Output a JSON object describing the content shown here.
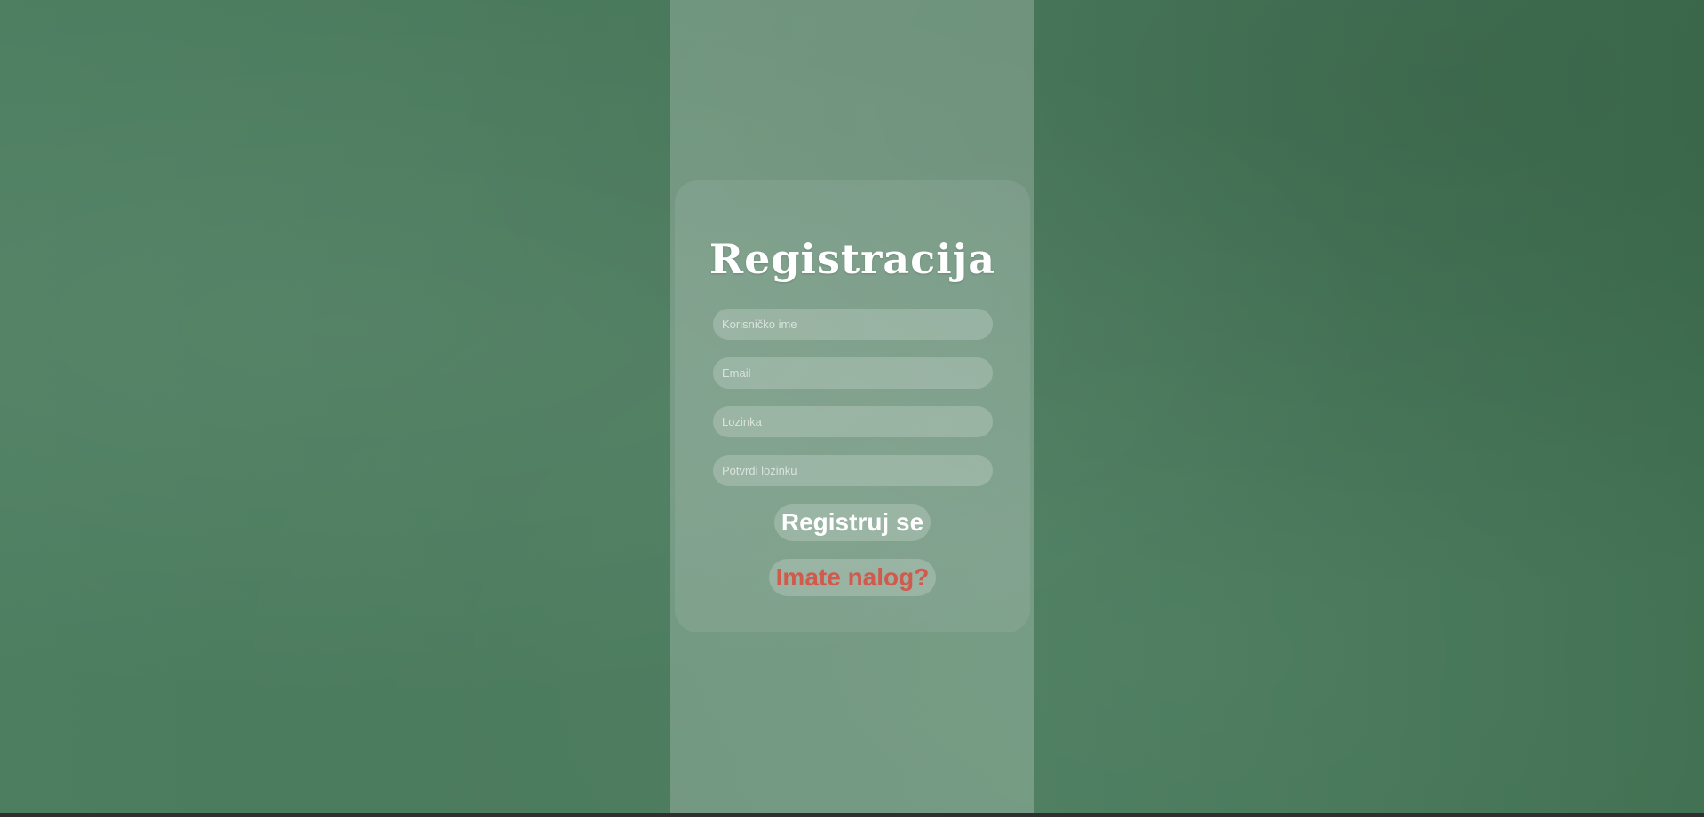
{
  "form": {
    "title": "Registracija",
    "fields": {
      "username_placeholder": "Korisničko ime",
      "email_placeholder": "Email",
      "password_placeholder": "Lozinka",
      "confirm_password_placeholder": "Potvrdi lozinku"
    },
    "register_label": "Registruj se",
    "login_link_label": "Imate nalog?"
  },
  "colors": {
    "background": "#4b7c5e",
    "login_link": "#d05a4e",
    "text": "#ffffff"
  }
}
